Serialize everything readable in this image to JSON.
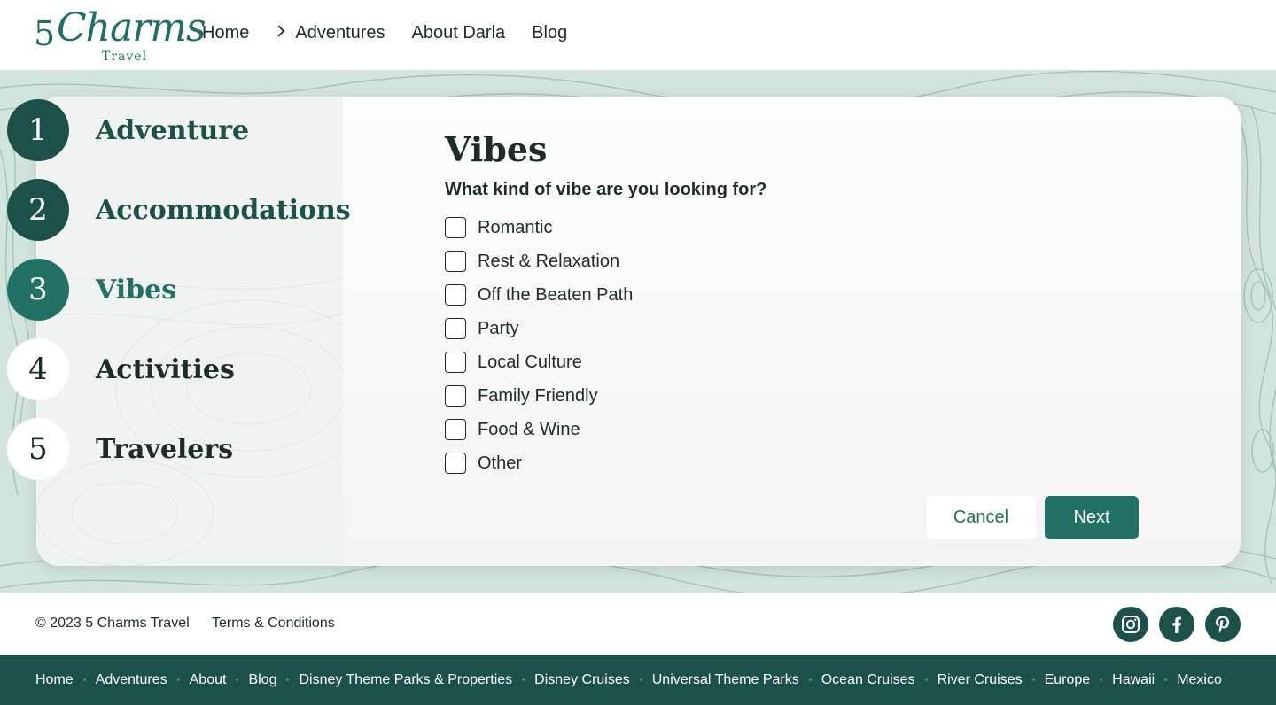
{
  "brand": {
    "mark": "5",
    "name": "Charms",
    "sub": "Travel"
  },
  "nav": {
    "home": "Home",
    "adventures": "Adventures",
    "about": "About Darla",
    "blog": "Blog"
  },
  "steps": [
    {
      "num": "1",
      "label": "Adventure",
      "state": "done"
    },
    {
      "num": "2",
      "label": "Accommodations",
      "state": "done"
    },
    {
      "num": "3",
      "label": "Vibes",
      "state": "active"
    },
    {
      "num": "4",
      "label": "Activities",
      "state": "todo"
    },
    {
      "num": "5",
      "label": "Travelers",
      "state": "todo"
    }
  ],
  "form": {
    "title": "Vibes",
    "question": "What kind of vibe are you looking for?",
    "options": [
      "Romantic",
      "Rest & Relaxation",
      "Off the Beaten Path",
      "Party",
      "Local Culture",
      "Family Friendly",
      "Food & Wine",
      "Other"
    ],
    "cancel": "Cancel",
    "next": "Next"
  },
  "footer": {
    "copyright": "© 2023 5 Charms Travel",
    "terms": "Terms & Conditions",
    "social": [
      "instagram-icon",
      "facebook-icon",
      "pinterest-icon"
    ]
  },
  "bottom_nav": [
    "Home",
    "Adventures",
    "About",
    "Blog",
    "Disney Theme Parks & Properties",
    "Disney Cruises",
    "Universal Theme Parks",
    "Ocean Cruises",
    "River Cruises",
    "Europe",
    "Hawaii",
    "Mexico"
  ],
  "colors": {
    "primary": "#217265",
    "dark": "#1b5149",
    "background": "#d3e4de"
  }
}
